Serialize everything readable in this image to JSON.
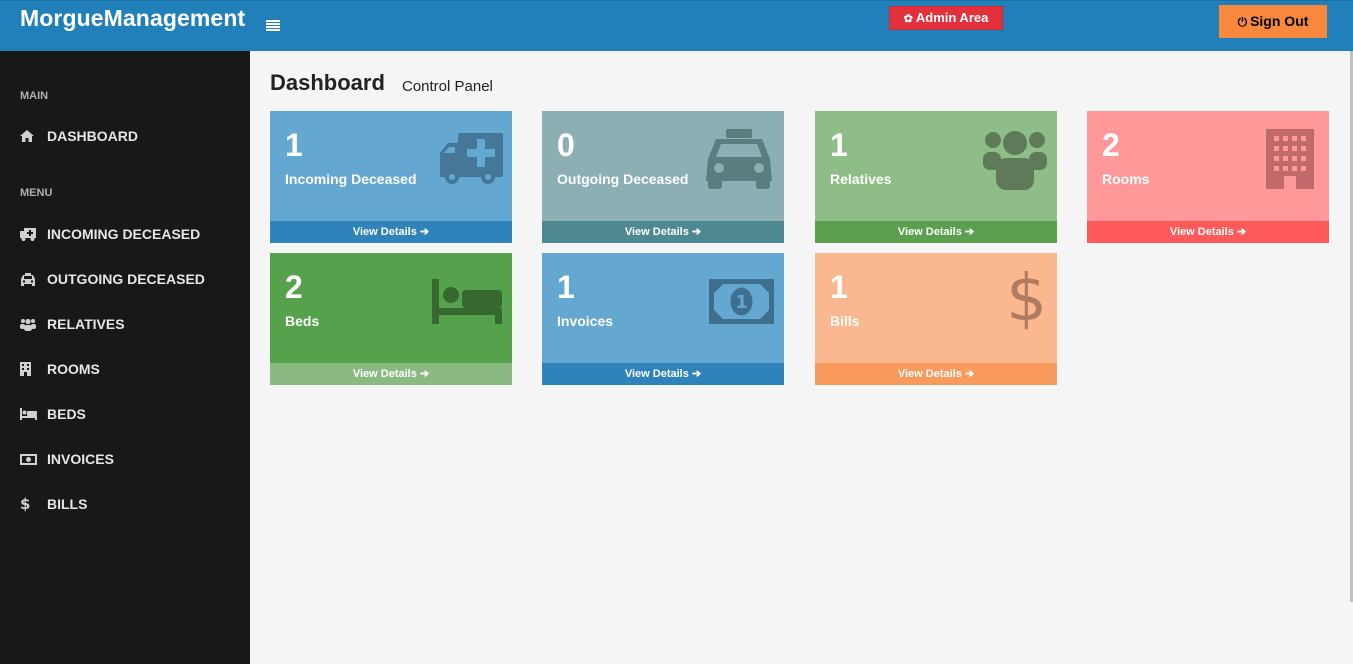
{
  "header": {
    "brand": "MorgueManagement",
    "admin_label": "Admin Area",
    "signout_label": "Sign Out"
  },
  "sidebar": {
    "main_header": "MAIN",
    "menu_header": "MENU",
    "items": [
      {
        "label": "DASHBOARD",
        "icon": "home-icon"
      },
      {
        "label": "INCOMING DECEASED",
        "icon": "ambulance-icon"
      },
      {
        "label": "OUTGOING DECEASED",
        "icon": "taxi-icon"
      },
      {
        "label": "RELATIVES",
        "icon": "users-icon"
      },
      {
        "label": "ROOMS",
        "icon": "building-icon"
      },
      {
        "label": "BEDS",
        "icon": "bed-icon"
      },
      {
        "label": "INVOICES",
        "icon": "money-icon"
      },
      {
        "label": "BILLS",
        "icon": "dollar-icon"
      }
    ]
  },
  "page": {
    "title": "Dashboard",
    "subtitle": "Control Panel"
  },
  "cards": [
    {
      "count": "1",
      "label": "Incoming Deceased",
      "footer": "View Details",
      "icon": "ambulance-icon",
      "color": "#64a7d1",
      "footer_color": "#2d83ba"
    },
    {
      "count": "0",
      "label": "Outgoing Deceased",
      "footer": "View Details",
      "icon": "taxi-icon",
      "color": "#8cafb3",
      "footer_color": "#4e8890"
    },
    {
      "count": "1",
      "label": "Relatives",
      "footer": "View Details",
      "icon": "users-icon",
      "color": "#8fbd87",
      "footer_color": "#5aa04f"
    },
    {
      "count": "2",
      "label": "Rooms",
      "footer": "View Details",
      "icon": "building-icon",
      "color": "#ff9999",
      "footer_color": "#ff5a5a"
    },
    {
      "count": "2",
      "label": "Beds",
      "footer": "View Details",
      "icon": "bed-icon",
      "color": "#56a14b",
      "footer_color": "#8ab982"
    },
    {
      "count": "1",
      "label": "Invoices",
      "footer": "View Details",
      "icon": "money-icon",
      "color": "#64a7d1",
      "footer_color": "#2d83ba"
    },
    {
      "count": "1",
      "label": "Bills",
      "footer": "View Details",
      "icon": "dollar-icon",
      "color": "#fbb78f",
      "footer_color": "#f79a5c"
    }
  ]
}
